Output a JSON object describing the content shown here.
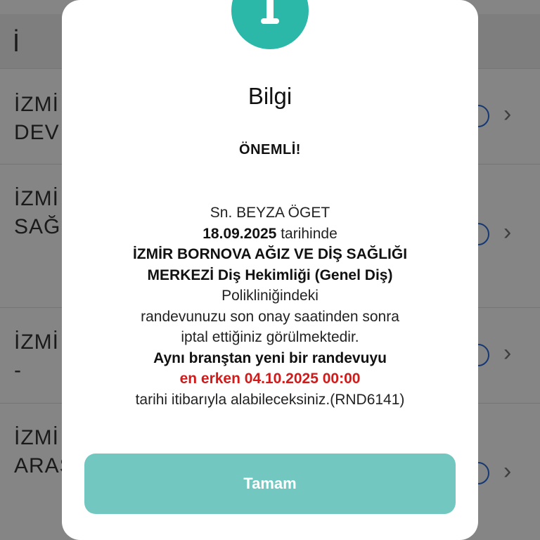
{
  "background": {
    "header_title": "İ",
    "items": [
      {
        "text": "İZMİ\nDEV"
      },
      {
        "text": "İZMİ\nSAĞ"
      },
      {
        "text": "İZMİ\n-"
      },
      {
        "text": "İZMİ\nARAS"
      }
    ],
    "chevron": "›"
  },
  "dialog": {
    "icon": "info-icon",
    "title": "Bilgi",
    "important": "ÖNEMLİ!",
    "message": {
      "greeting": "Sn. BEYZA ÖGET",
      "date": "18.09.2025",
      "date_suffix": " tarihinde",
      "clinic": "İZMİR BORNOVA AĞIZ VE DİŞ SAĞLIĞI MERKEZİ Diş Hekimliği (Genel Diş)",
      "clinic_suffix": "Polikliniğindeki",
      "line_cancel_1": "randevunuzu son onay saatinden sonra",
      "line_cancel_2": "iptal ettiğiniz görülmektedir.",
      "branch_line": "Aynı branştan yeni bir randevuyu",
      "earliest": "en erken 04.10.2025 00:00",
      "closing": "tarihi itibarıyla alabileceksiniz.(RND6141)"
    },
    "ok_label": "Tamam"
  },
  "colors": {
    "accent": "#2bb8a8",
    "button": "#72c8c1",
    "warning_text": "#d11a1a",
    "overlay": "rgba(0,0,0,0.48)"
  }
}
